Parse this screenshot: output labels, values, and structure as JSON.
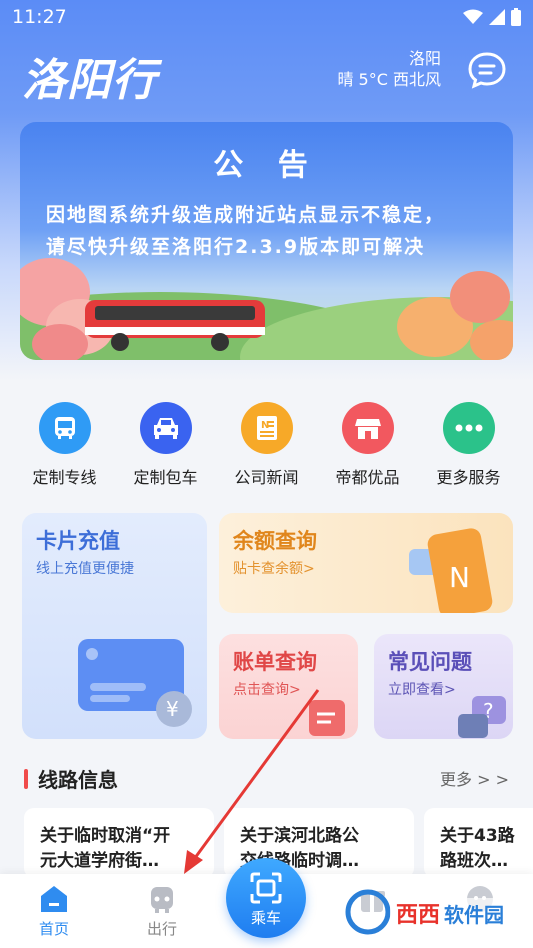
{
  "status_bar": {
    "time": "11:27"
  },
  "header": {
    "app_logo": "洛阳行",
    "city": "洛阳",
    "weather": "晴 5°C 西北风",
    "message_icon": "chat-bubble-icon"
  },
  "banner": {
    "title": "公 告",
    "line1": "因地图系统升级造成附近站点显示不稳定，",
    "line2": "请尽快升级至洛阳行2.3.9版本即可解决"
  },
  "quick_actions": [
    {
      "label": "定制专线",
      "icon": "bus-icon",
      "color": "#2f9bf5"
    },
    {
      "label": "定制包车",
      "icon": "car-icon",
      "color": "#3a63f0"
    },
    {
      "label": "公司新闻",
      "icon": "news-icon",
      "color": "#f7a928"
    },
    {
      "label": "帝都优品",
      "icon": "shop-icon",
      "color": "#f2585f"
    },
    {
      "label": "更多服务",
      "icon": "more-dots-icon",
      "color": "#2bc28a"
    }
  ],
  "cards": {
    "recharge": {
      "title": "卡片充值",
      "subtitle": "线上充值更便捷"
    },
    "balance": {
      "title": "余额查询",
      "subtitle": "贴卡查余额>"
    },
    "bill": {
      "title": "账单查询",
      "subtitle": "点击查询>"
    },
    "faq": {
      "title": "常见问题",
      "subtitle": "立即查看>"
    }
  },
  "routes_section": {
    "title": "线路信息",
    "more": "更多 > >",
    "items": [
      {
        "line1": "关于临时取消“开",
        "line2": "元大道学府街…"
      },
      {
        "line1": "关于滨河北路公",
        "line2": "交线路临时调…"
      },
      {
        "line1": "关于43路",
        "line2": "路班次…"
      }
    ]
  },
  "tabbar": {
    "home": "首页",
    "travel": "出行",
    "ride": "乘车"
  },
  "colors": {
    "primary": "#5b8cf6",
    "accent_red": "#f04b4b",
    "tab_active": "#2f8cf0"
  }
}
